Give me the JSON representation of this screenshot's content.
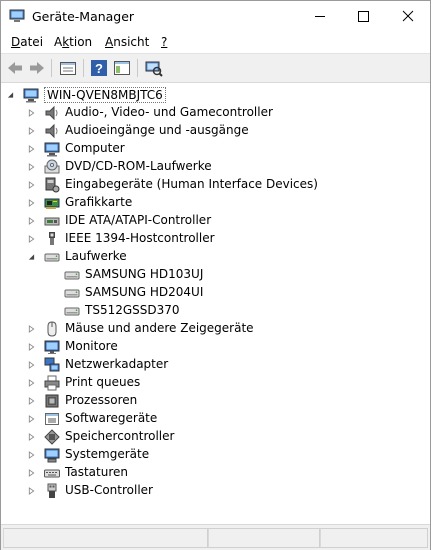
{
  "window": {
    "title": "Geräte-Manager"
  },
  "menu": [
    {
      "label": "Datei",
      "key": "D"
    },
    {
      "label": "Aktion",
      "key": "k"
    },
    {
      "label": "Ansicht",
      "key": "A"
    },
    {
      "label": "?",
      "key": "?"
    }
  ],
  "toolbar": [
    {
      "name": "back-arrow-icon"
    },
    {
      "name": "forward-arrow-icon"
    },
    {
      "name": "properties-icon"
    },
    {
      "name": "help-icon"
    },
    {
      "name": "console-tree-icon"
    },
    {
      "name": "scan-hardware-icon"
    }
  ],
  "tree": {
    "root": "WIN-QVEN8MBJTC6",
    "categories": [
      {
        "label": "Audio-, Video- und Gamecontroller",
        "icon": "speaker-icon",
        "expanded": false,
        "children": []
      },
      {
        "label": "Audioeingänge und -ausgänge",
        "icon": "speaker-icon",
        "expanded": false,
        "children": []
      },
      {
        "label": "Computer",
        "icon": "computer-icon",
        "expanded": false,
        "children": []
      },
      {
        "label": "DVD/CD-ROM-Laufwerke",
        "icon": "dvd-drive-icon",
        "expanded": false,
        "children": []
      },
      {
        "label": "Eingabegeräte (Human Interface Devices)",
        "icon": "hid-icon",
        "expanded": false,
        "children": []
      },
      {
        "label": "Grafikkarte",
        "icon": "display-adapter-icon",
        "expanded": false,
        "children": []
      },
      {
        "label": "IDE ATA/ATAPI-Controller",
        "icon": "ide-controller-icon",
        "expanded": false,
        "children": []
      },
      {
        "label": "IEEE 1394-Hostcontroller",
        "icon": "firewire-icon",
        "expanded": false,
        "children": []
      },
      {
        "label": "Laufwerke",
        "icon": "disk-drive-icon",
        "expanded": true,
        "children": [
          "SAMSUNG HD103UJ",
          "SAMSUNG HD204UI",
          "TS512GSSD370"
        ]
      },
      {
        "label": "Mäuse und andere Zeigegeräte",
        "icon": "mouse-icon",
        "expanded": false,
        "children": []
      },
      {
        "label": "Monitore",
        "icon": "monitor-icon",
        "expanded": false,
        "children": []
      },
      {
        "label": "Netzwerkadapter",
        "icon": "network-adapter-icon",
        "expanded": false,
        "children": []
      },
      {
        "label": "Print queues",
        "icon": "printer-icon",
        "expanded": false,
        "children": []
      },
      {
        "label": "Prozessoren",
        "icon": "processor-icon",
        "expanded": false,
        "children": []
      },
      {
        "label": "Softwaregeräte",
        "icon": "software-device-icon",
        "expanded": false,
        "children": []
      },
      {
        "label": "Speichercontroller",
        "icon": "storage-controller-icon",
        "expanded": false,
        "children": []
      },
      {
        "label": "Systemgeräte",
        "icon": "system-device-icon",
        "expanded": false,
        "children": []
      },
      {
        "label": "Tastaturen",
        "icon": "keyboard-icon",
        "expanded": false,
        "children": []
      },
      {
        "label": "USB-Controller",
        "icon": "usb-icon",
        "expanded": false,
        "children": []
      }
    ]
  },
  "colors": {
    "toolbar_bg": "#f0f0f0",
    "accent": "#1e6fd0"
  }
}
